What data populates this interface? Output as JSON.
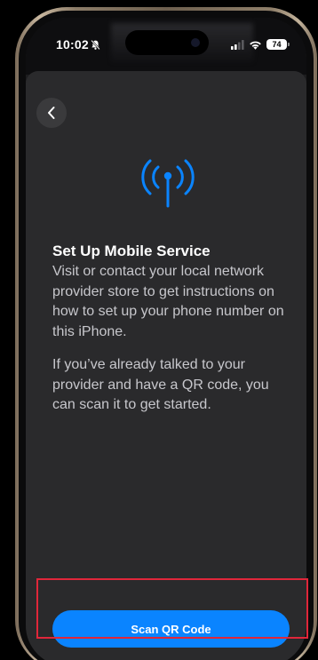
{
  "status_bar": {
    "time": "10:02",
    "battery_level": "74",
    "icons": [
      "bell-slash-icon",
      "cellular-signal-icon",
      "wifi-icon",
      "battery-icon"
    ]
  },
  "navigation": {
    "back_icon": "chevron-left-icon"
  },
  "hero": {
    "icon": "antenna-radiowaves-icon",
    "icon_color": "#0a84ff"
  },
  "content": {
    "title": "Set Up Mobile Service",
    "paragraph_1": "Visit or contact your local network provider store to get instructions on how to set up your phone number on this iPhone.",
    "paragraph_2": "If you’ve already talked to your provider and have a QR code, you can scan it to get started."
  },
  "actions": {
    "primary_label": "Scan QR Code",
    "primary_color": "#0a84ff"
  },
  "highlight_color": "#e0263a"
}
